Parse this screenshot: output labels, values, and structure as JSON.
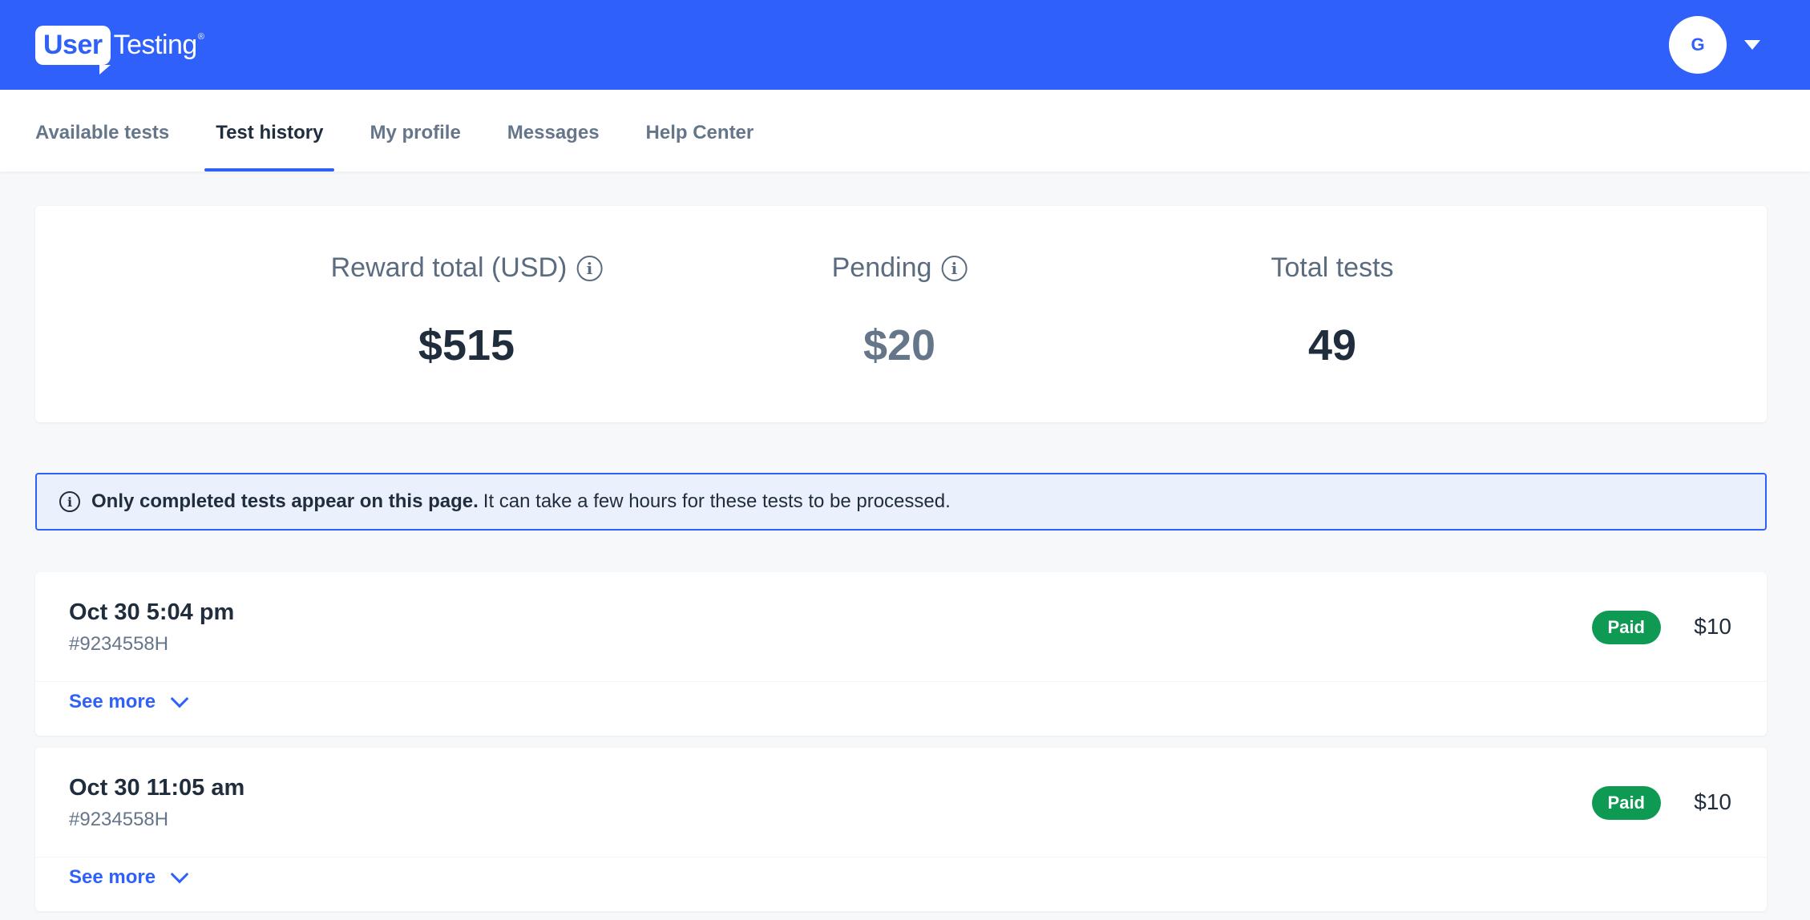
{
  "header": {
    "logo": {
      "part1": "User",
      "part2": "Testing",
      "mark": "®"
    },
    "avatar_initial": "G"
  },
  "tabs": [
    {
      "label": "Available tests",
      "active": false
    },
    {
      "label": "Test history",
      "active": true
    },
    {
      "label": "My profile",
      "active": false
    },
    {
      "label": "Messages",
      "active": false
    },
    {
      "label": "Help Center",
      "active": false
    }
  ],
  "stats": {
    "reward": {
      "label": "Reward total (USD)",
      "value": "$515"
    },
    "pending": {
      "label": "Pending",
      "value": "$20"
    },
    "total": {
      "label": "Total tests",
      "value": "49"
    }
  },
  "notice": {
    "bold": "Only completed tests appear on this page.",
    "text": "It can take a few hours for these tests to be processed."
  },
  "tests": [
    {
      "date": "Oct 30 5:04 pm",
      "id": "#9234558H",
      "status": "Paid",
      "amount": "$10",
      "see_more": "See more"
    },
    {
      "date": "Oct 30 11:05 am",
      "id": "#9234558H",
      "status": "Paid",
      "amount": "$10",
      "see_more": "See more"
    }
  ],
  "colors": {
    "brand": "#3060fa",
    "paid": "#0f9a53",
    "notice_bg": "#ebf0fd"
  },
  "icons": {
    "info": "info-icon",
    "caret": "caret-down-icon",
    "chevron": "chevron-down-icon"
  }
}
